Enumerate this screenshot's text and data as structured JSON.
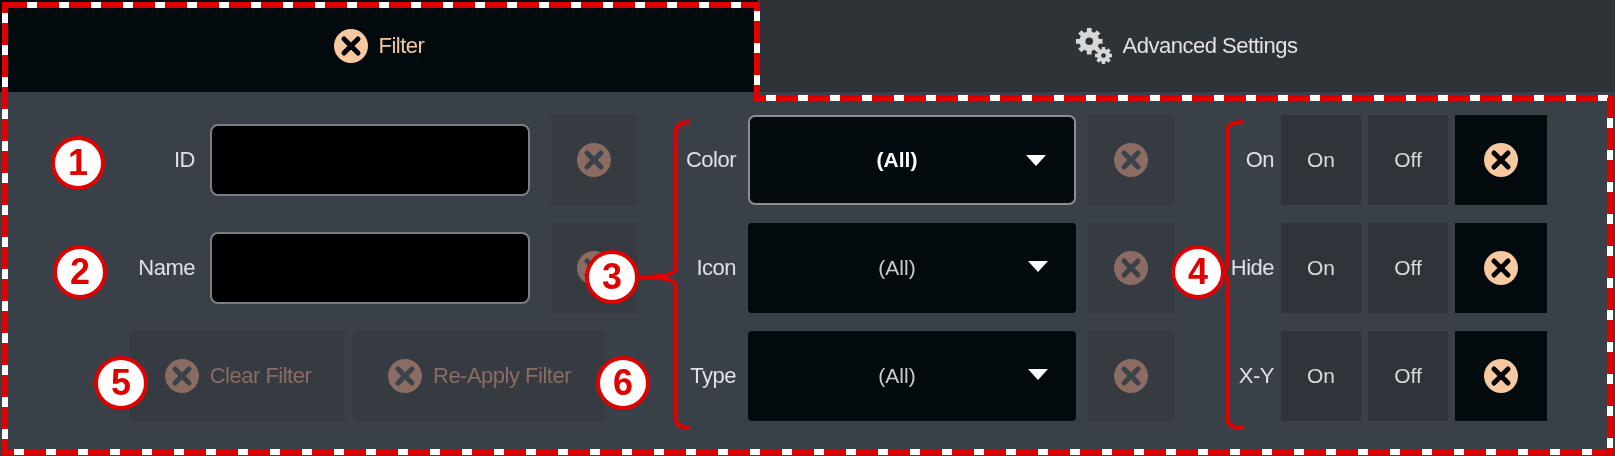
{
  "tabs": [
    {
      "label": "Filter",
      "selected": true
    },
    {
      "label": "Advanced Settings",
      "selected": false
    }
  ],
  "text_filters": [
    {
      "label": "ID",
      "clear_disabled": true
    },
    {
      "label": "Name",
      "clear_disabled": true
    }
  ],
  "actions": [
    {
      "label": "Clear Filter",
      "disabled": true
    },
    {
      "label": "Re-Apply Filter",
      "disabled": true
    }
  ],
  "dropdowns": [
    {
      "label": "Color",
      "value": "(All)",
      "focused": true,
      "clear_disabled": true
    },
    {
      "label": "Icon",
      "value": "(All)",
      "focused": false,
      "clear_disabled": true
    },
    {
      "label": "Type",
      "value": "(All)",
      "focused": false,
      "clear_disabled": true
    }
  ],
  "toggles": [
    {
      "label": "On",
      "options": [
        {
          "label": "On",
          "selected": false
        },
        {
          "label": "Off",
          "selected": false
        }
      ],
      "clear_disabled": false
    },
    {
      "label": "Hide",
      "options": [
        {
          "label": "On",
          "selected": false
        },
        {
          "label": "Off",
          "selected": false
        }
      ],
      "clear_disabled": false
    },
    {
      "label": "X-Y",
      "options": [
        {
          "label": "On",
          "selected": false
        },
        {
          "label": "Off",
          "selected": false
        }
      ],
      "clear_disabled": false
    }
  ],
  "callouts": [
    {
      "number": "1"
    },
    {
      "number": "2"
    },
    {
      "number": "3"
    },
    {
      "number": "4"
    },
    {
      "number": "5"
    },
    {
      "number": "6"
    }
  ]
}
